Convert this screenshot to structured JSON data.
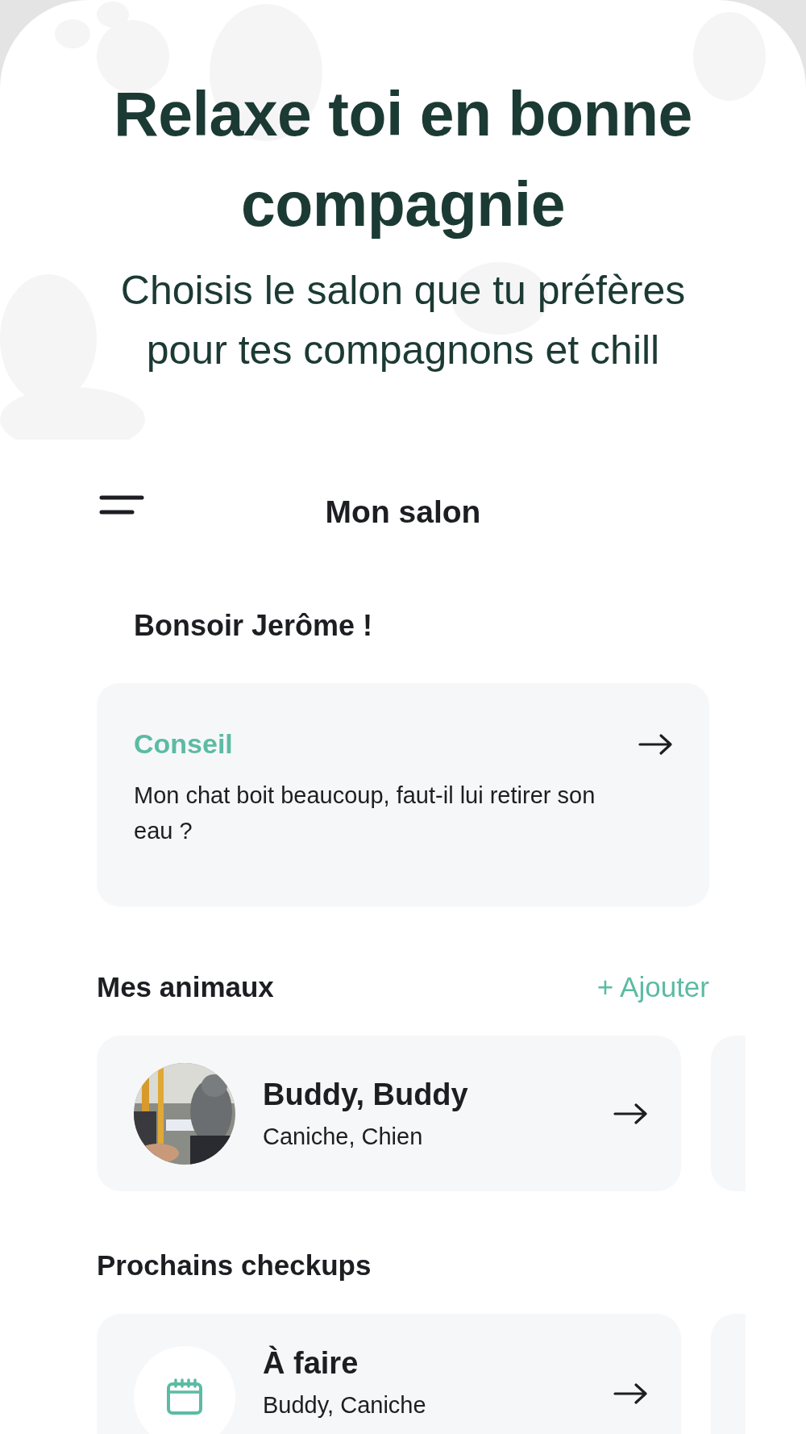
{
  "hero": {
    "title": "Relaxe toi en bonne compagnie",
    "subtitle": "Choisis le salon que tu préfères pour tes compagnons et chill"
  },
  "header": {
    "title": "Mon salon"
  },
  "greeting": "Bonsoir Jerôme !",
  "tip": {
    "label": "Conseil",
    "text": "Mon chat boit beaucoup, faut-il lui retirer son eau ?"
  },
  "pets": {
    "title": "Mes animaux",
    "add_button": "+ Ajouter",
    "items": [
      {
        "name": "Buddy, Buddy",
        "details": "Caniche, Chien",
        "kind": "picture"
      }
    ]
  },
  "checkups": {
    "title": "Prochains checkups",
    "items": [
      {
        "status": "À faire",
        "details": "Buddy, Caniche",
        "kind": "calendar"
      }
    ]
  }
}
